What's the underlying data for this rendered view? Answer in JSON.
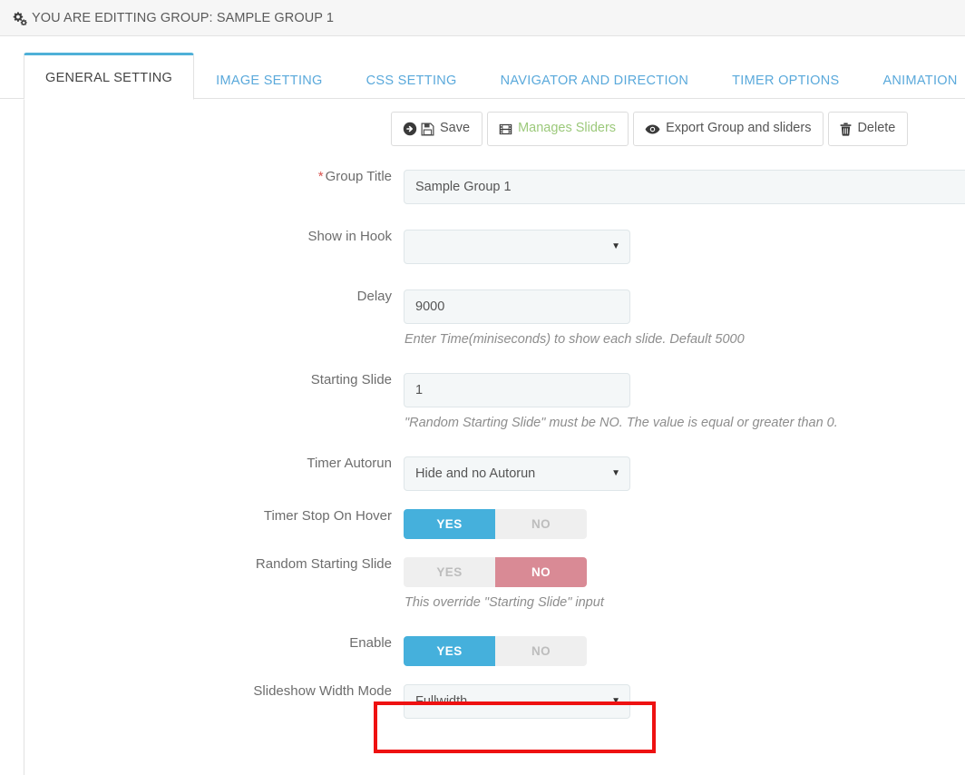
{
  "header": {
    "icon": "cogs-icon",
    "title": "YOU ARE EDITTING GROUP: SAMPLE GROUP 1"
  },
  "tabs": [
    {
      "label": "GENERAL SETTING",
      "active": true
    },
    {
      "label": "IMAGE SETTING",
      "active": false
    },
    {
      "label": "CSS SETTING",
      "active": false
    },
    {
      "label": "NAVIGATOR AND DIRECTION",
      "active": false
    },
    {
      "label": "TIMER OPTIONS",
      "active": false
    },
    {
      "label": "ANIMATION",
      "active": false
    }
  ],
  "toolbar": {
    "save_label": "Save",
    "manages_sliders_label": "Manages Sliders",
    "export_label": "Export Group and sliders",
    "delete_label": "Delete"
  },
  "form": {
    "group_title": {
      "required_mark": "*",
      "label": "Group Title",
      "value": "Sample Group 1"
    },
    "show_in_hook": {
      "label": "Show in Hook",
      "value": "",
      "arrow": "▼"
    },
    "delay": {
      "label": "Delay",
      "value": "9000",
      "help": "Enter Time(miniseconds) to show each slide. Default 5000"
    },
    "starting_slide": {
      "label": "Starting Slide",
      "value": "1",
      "help": "\"Random Starting Slide\" must be NO. The value is equal or greater than 0."
    },
    "timer_autorun": {
      "label": "Timer Autorun",
      "value": "Hide and no Autorun",
      "arrow": "▼"
    },
    "timer_stop_on_hover": {
      "label": "Timer Stop On Hover",
      "yes": "YES",
      "no": "NO",
      "selected": "YES"
    },
    "random_starting_slide": {
      "label": "Random Starting Slide",
      "yes": "YES",
      "no": "NO",
      "selected": "NO",
      "help": "This override \"Starting Slide\" input"
    },
    "enable": {
      "label": "Enable",
      "yes": "YES",
      "no": "NO",
      "selected": "YES"
    },
    "slideshow_width_mode": {
      "label": "Slideshow Width Mode",
      "value": "Fullwidth",
      "arrow": "▼",
      "highlighted": true
    }
  },
  "colors": {
    "accent_blue": "#45b0dc",
    "tab_link": "#5aa9db",
    "switch_no": "#d98a95",
    "green_text": "#9cc97b",
    "required_red": "#d9534f",
    "highlight_red": "#ee1111"
  }
}
